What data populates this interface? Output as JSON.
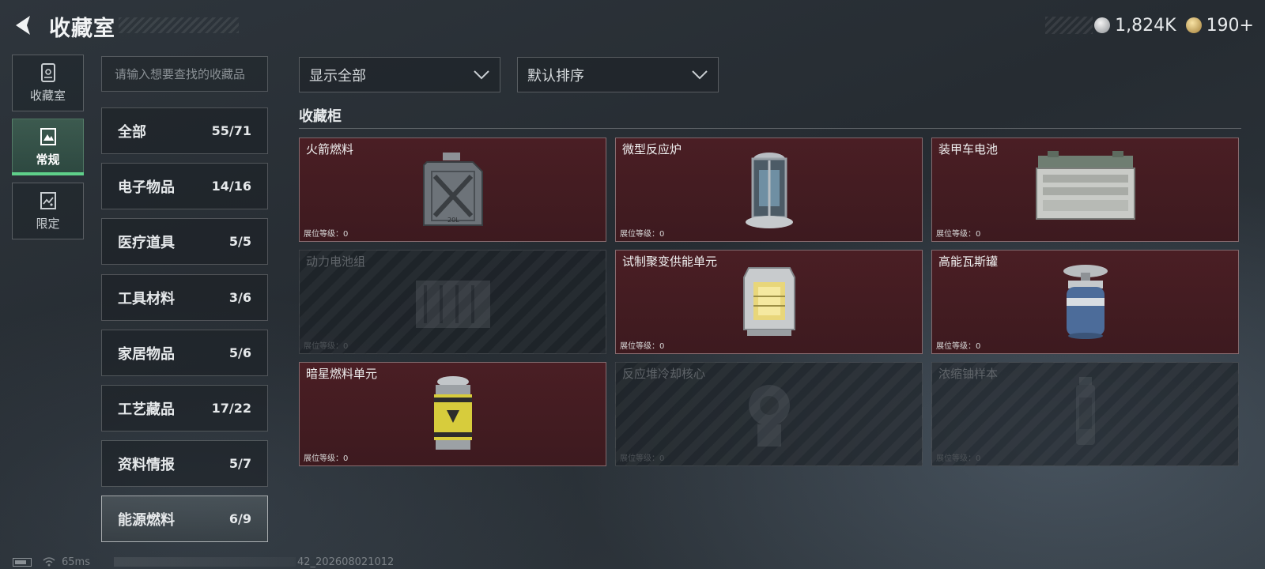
{
  "header": {
    "title": "收藏室"
  },
  "currency": [
    {
      "icon": "silver-coin-icon",
      "value": "1,824K"
    },
    {
      "icon": "gold-coin-icon",
      "value": "190+"
    }
  ],
  "nav_tabs": [
    {
      "label": "收藏室",
      "icon": "display-case-icon",
      "active": false
    },
    {
      "label": "常规",
      "icon": "regular-collection-icon",
      "active": true
    },
    {
      "label": "限定",
      "icon": "limited-collection-icon",
      "active": false
    }
  ],
  "search": {
    "placeholder": "请输入想要查找的收藏品"
  },
  "categories": [
    {
      "name": "全部",
      "count": "55/71",
      "active": false
    },
    {
      "name": "电子物品",
      "count": "14/16",
      "active": false
    },
    {
      "name": "医疗道具",
      "count": "5/5",
      "active": false
    },
    {
      "name": "工具材料",
      "count": "3/6",
      "active": false
    },
    {
      "name": "家居物品",
      "count": "5/6",
      "active": false
    },
    {
      "name": "工艺藏品",
      "count": "17/22",
      "active": false
    },
    {
      "name": "资料情报",
      "count": "5/7",
      "active": false
    },
    {
      "name": "能源燃料",
      "count": "6/9",
      "active": true
    }
  ],
  "filters": {
    "display": "显示全部",
    "sort": "默认排序"
  },
  "section": {
    "title": "收藏柜"
  },
  "items": [
    {
      "name": "火箭燃料",
      "level": "展位等级：0",
      "owned": true,
      "icon": "fuel-canister-icon",
      "canister_mark": "20L"
    },
    {
      "name": "微型反应炉",
      "level": "展位等级：0",
      "owned": true,
      "icon": "micro-reactor-icon"
    },
    {
      "name": "装甲车电池",
      "level": "展位等级：0",
      "owned": true,
      "icon": "vehicle-battery-icon"
    },
    {
      "name": "动力电池组",
      "level": "展位等级：0",
      "owned": false,
      "icon": "battery-pack-icon"
    },
    {
      "name": "试制聚变供能单元",
      "level": "展位等级：0",
      "owned": true,
      "icon": "fusion-unit-icon"
    },
    {
      "name": "高能瓦斯罐",
      "level": "展位等级：0",
      "owned": true,
      "icon": "gas-tank-icon"
    },
    {
      "name": "暗星燃料单元",
      "level": "展位等级：0",
      "owned": true,
      "icon": "fuel-cell-icon"
    },
    {
      "name": "反应堆冷却核心",
      "level": "展位等级：0",
      "owned": false,
      "icon": "cooling-core-icon"
    },
    {
      "name": "浓缩铀样本",
      "level": "展位等级：0",
      "owned": false,
      "icon": "uranium-sample-icon"
    }
  ],
  "footer": {
    "ping": "65ms",
    "build": "42_202608021012"
  }
}
